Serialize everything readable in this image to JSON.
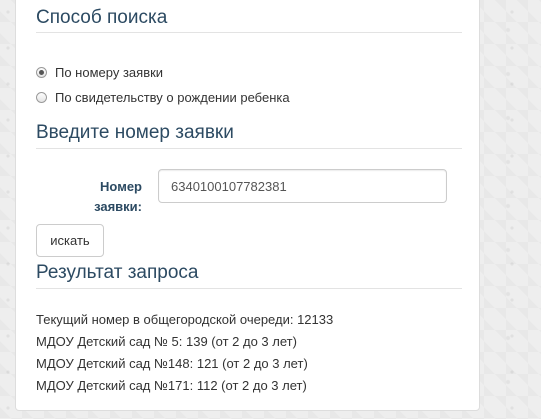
{
  "search_method": {
    "title": "Способ поиска",
    "options": [
      {
        "label": "По номеру заявки",
        "checked": true
      },
      {
        "label": "По свидетельству о рождении ребенка",
        "checked": false
      }
    ]
  },
  "application_number": {
    "title": "Введите номер заявки",
    "field_label_line1": "Номер",
    "field_label_line2": "заявки:",
    "value": "6340100107782381",
    "search_button": "искать"
  },
  "result": {
    "title": "Результат запроса",
    "lines": [
      "Текущий номер в общегородской очереди: 12133",
      "МДОУ Детский сад № 5: 139 (от 2 до 3 лет)",
      "МДОУ Детский сад №148: 121 (от 2 до 3 лет)",
      "МДОУ Детский сад №171: 112 (от 2 до 3 лет)"
    ]
  }
}
